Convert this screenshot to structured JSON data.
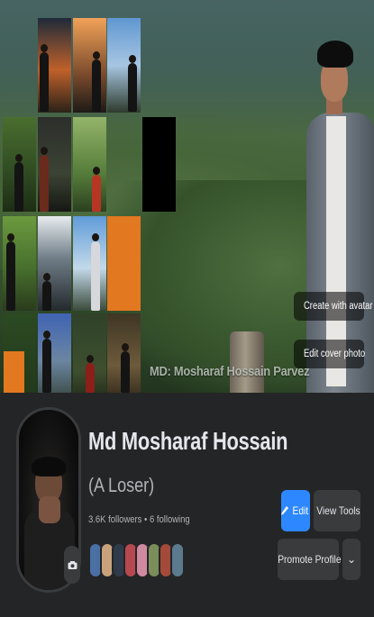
{
  "cover": {
    "watermark": "MD: Mosharaf Hossain Parvez",
    "create_avatar_label": "Create with avatar",
    "edit_cover_label": "Edit cover photo"
  },
  "profile": {
    "name": "Md Mosharaf Hossain",
    "bio": "(A Loser)",
    "stats": "3.6K followers • 6 following"
  },
  "actions": {
    "edit_label": "Edit",
    "view_tools_label": "View Tools",
    "promote_label": "Promote Profile",
    "more_label": "⌄"
  },
  "colors": {
    "background": "#242526",
    "primary_button": "#2d88ff",
    "secondary_button": "#3a3b3c",
    "text_primary": "#e4e6eb",
    "text_secondary": "#b0b3b8"
  }
}
